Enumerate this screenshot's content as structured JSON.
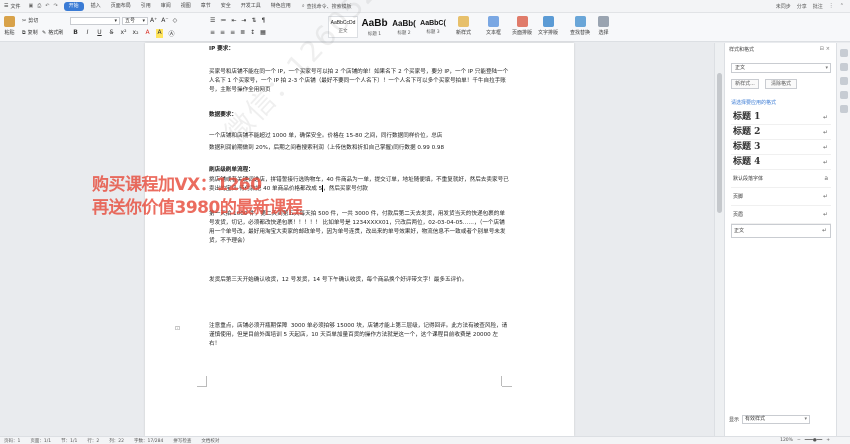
{
  "menubar": {
    "file_label": "文件",
    "tabs": [
      "开始",
      "插入",
      "页面布局",
      "引用",
      "审阅",
      "视图",
      "章节",
      "安全",
      "开发工具",
      "特色应用"
    ],
    "active_tab": "开始",
    "search": "查找命令、搜索模板",
    "right": [
      "未同步",
      "分享",
      "批注"
    ]
  },
  "ribbon": {
    "paste": "粘贴",
    "cut": "剪切",
    "copy": "复制",
    "format_painter": "格式刷",
    "font_name": "",
    "font_size": "五号",
    "styles": [
      {
        "preview": "AaBbCcDd",
        "name": "正文"
      },
      {
        "preview": "AaBb",
        "name": "标题 1"
      },
      {
        "preview": "AaBb(",
        "name": "标题 2"
      },
      {
        "preview": "AaBbC(",
        "name": "标题 3"
      }
    ],
    "new_style": "新样式",
    "text_tools": "文字排版",
    "find_replace": "查找替换",
    "select": "选择",
    "text_box": "文本框",
    "page_layout_btn": "页面排版"
  },
  "document": {
    "h1": "IP 要求：",
    "p1": "买家号和店铺不能在同一个 IP，一个买家号可以拍 2 个店铺的单！如果名下 2 个买家号，要分 IP，一个 IP 只能登陆一个人名下 1 个买家号，一个 IP 拍 2-3 个店铺（最好不要同一个人名下）！一个人名下可以多个买家号拍单！千牛自拉手账号，主账号操作全用网页",
    "h2": "数据要求：",
    "p2a": "一个店铺和店铺不能超过 1000 单，确保安全。价格在 15-80 之间，同行数据同样价位，总店",
    "p2b": "数据利润前期做到 20%，后期之间看搜索利润（上传信数和折扣自己掌握)同行数据 0.99 0.98",
    "h3": "刷店级刷单流程：",
    "p3a": "挑店铺或者关键词选店，拼错誓接行选购物车，40 件商品为一单，提交订单，地址随便填，不重复就好，然后去卖家号已卖出的宝贝-待付款把 40 单商品价格都改成 5",
    "p3b": "，然后买家号付款",
    "p4": "第一天拍 1000 件，第二天到第五天每天拍 500 件，一共 3000 件，付款后第二天去发货，用发货当天的快递包裹的单号发货，切记，必须都改快递包裹！！！！！ 比如单号是 1234XXXX01，只改后两位，02-03-04-05……，（一个店铺用一个单号改，最好用淘宝大卖家的邮政单号，因为单号连贯，改出来的单号效果好，物流信息不一致或者个别单号未发货，不予理会）",
    "p5": "发货后第三天开始确认收货，12 号发货，14 号下午确认收货，每个商品换个好评带文字！最多五评价。",
    "p6": "注意重点，店铺必须开瓶期保障  3000 单必须拍够 15000 块，店铺才能上第三层级，记得回评。此方法有被查风险，请谨慎使用，但是目前外面培训 5 天起店，10 天百单加量百货的操作方法就是这一个，这个课程目前收费是 20000 左右！"
  },
  "overlay": {
    "promo_line1": "购买课程加VX：1260",
    "promo_line2": "再送你价值3980的最新课程",
    "watermark": "微信：1260521"
  },
  "panel": {
    "title": "样式和格式",
    "current_style": "正文",
    "new_style_btn": "新样式...",
    "clear_format_btn": "清除格式",
    "hint": "请选择要应用的格式",
    "styles": [
      "标题 1",
      "标题 2",
      "标题 3",
      "标题 4",
      "默认段落字体",
      "页脚",
      "页眉",
      "正文"
    ],
    "show_label": "显示",
    "show_value": "有效样式"
  },
  "status": {
    "page": "页码：1",
    "pages": "页面：1/1",
    "section": "节：1/1",
    "row": "行：2",
    "col": "列：22",
    "words": "字数：17/284",
    "spell": "拼写检查",
    "doc_check": "文档校对",
    "zoom": "120%"
  },
  "colors": {
    "accent": "#3a7bd5",
    "promo": "#e74c3c"
  }
}
